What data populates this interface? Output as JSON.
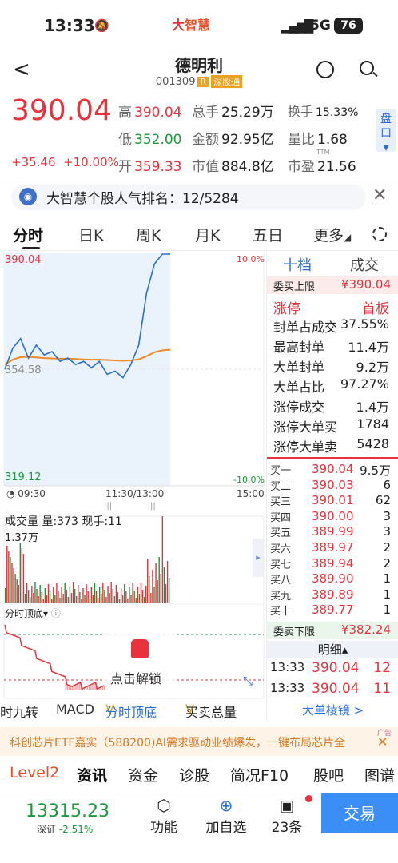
{
  "status": {
    "time": "13:33",
    "logo_a": "大",
    "logo_b": "智慧",
    "network": "5G",
    "battery": "76"
  },
  "stock": {
    "name": "德明利",
    "code": "001309",
    "tag_r": "R",
    "tag_sz": "深股通"
  },
  "quote": {
    "price": "390.04",
    "change": "+35.46",
    "pct": "+10.00%",
    "high_k": "高",
    "high": "390.04",
    "low_k": "低",
    "low": "352.00",
    "open_k": "开",
    "open": "359.33",
    "vol_k": "总手",
    "vol": "25.29万",
    "amt_k": "金额",
    "amt": "92.95亿",
    "mcap_k": "市值",
    "mcap": "884.8亿",
    "turn_k": "换手",
    "turn": "15.33%",
    "vr_k": "量比",
    "vr": "1.68",
    "pe_k": "市盈",
    "pe_tag": "TTM",
    "pe": "21.56",
    "pankou": "盘口"
  },
  "rank": {
    "text": "大智慧个股人气排名：12/5284"
  },
  "tabs": [
    "分时",
    "日K",
    "周K",
    "月K",
    "五日",
    "更多"
  ],
  "chart": {
    "top_price": "390.04",
    "mid_price": "354.58",
    "bottom_price": "319.12",
    "top_pct": "10.0%",
    "bottom_pct": "-10.0%",
    "t_start": "09:30",
    "t_mid": "11:30/13:00",
    "t_end": "15:00",
    "vol_label": "成交量",
    "vol_k": "量:373",
    "now_k": "现手:11",
    "vol_max": "1.37万",
    "ind_name": "分时顶底",
    "unlock": "点击解锁"
  },
  "chart_data": {
    "type": "line",
    "title": "",
    "x": [
      "09:30",
      "11:30/13:00",
      "15:00"
    ],
    "ylim": [
      319.12,
      390.04
    ],
    "series": [
      {
        "values": [
          354.6,
          361,
          364,
          358,
          362,
          359,
          360,
          357,
          358,
          356,
          357,
          355,
          357,
          353,
          354,
          352,
          356,
          362,
          378,
          387,
          390.04,
          390.04
        ]
      },
      {
        "values": [
          356,
          357.5,
          358.3,
          358.4,
          358.2,
          358.0,
          357.9,
          357.8,
          357.8,
          357.7,
          357.6,
          357.5,
          357.5,
          357.4,
          357.3,
          357.2,
          357.3,
          357.6,
          358.6,
          359.8,
          360.4,
          360.6
        ]
      }
    ]
  },
  "book": {
    "tab1": "十档",
    "tab2": "成交",
    "buy_limit_k": "委买上限",
    "buy_limit": "¥390.04",
    "limitup": "涨停",
    "limitup_r": "首板",
    "seal": [
      {
        "k": "封单占成交",
        "v": "37.55%"
      },
      {
        "k": "最高封单",
        "v": "11.4万"
      },
      {
        "k": "大单封单",
        "v": "9.2万"
      },
      {
        "k": "大单占比",
        "v": "97.27%"
      },
      {
        "k": "涨停成交",
        "v": "1.4万"
      },
      {
        "k": "涨停大单买",
        "v": "1784"
      },
      {
        "k": "涨停大单卖",
        "v": "5428"
      }
    ],
    "bids": [
      {
        "l": "买一",
        "p": "390.04",
        "v": "9.5万"
      },
      {
        "l": "买二",
        "p": "390.03",
        "v": "6"
      },
      {
        "l": "买三",
        "p": "390.01",
        "v": "62"
      },
      {
        "l": "买四",
        "p": "390.00",
        "v": "3"
      },
      {
        "l": "买五",
        "p": "389.99",
        "v": "3"
      },
      {
        "l": "买六",
        "p": "389.97",
        "v": "2"
      },
      {
        "l": "买七",
        "p": "389.94",
        "v": "2"
      },
      {
        "l": "买八",
        "p": "389.90",
        "v": "1"
      },
      {
        "l": "买九",
        "p": "389.89",
        "v": "1"
      },
      {
        "l": "买十",
        "p": "389.77",
        "v": "1"
      }
    ],
    "sell_limit_k": "委卖下限",
    "sell_limit": "¥382.24",
    "detail": "明细",
    "ticks": [
      {
        "t": "13:33",
        "p": "390.04",
        "v": "12"
      },
      {
        "t": "13:33",
        "p": "390.04",
        "v": "11"
      }
    ],
    "bigorder": "大单棱镜 >"
  },
  "toolbar2": {
    "a": "时九转",
    "b": "MACD",
    "c": "分时顶底",
    "d": "买卖总量"
  },
  "ad": {
    "text": "科创芯片ETF嘉实（588200)AI需求驱动业绩爆发，一键布局芯片全",
    "tag": "广告"
  },
  "newstabs": [
    "Level2",
    "资讯",
    "资金",
    "诊股",
    "简况F10",
    "股吧",
    "图谱"
  ],
  "bottom": {
    "index_val": "13315.23",
    "index_name": "深证",
    "index_pct": "-2.51%",
    "b1": "功能",
    "b2": "加自选",
    "b3": "23条",
    "trade": "交易"
  }
}
